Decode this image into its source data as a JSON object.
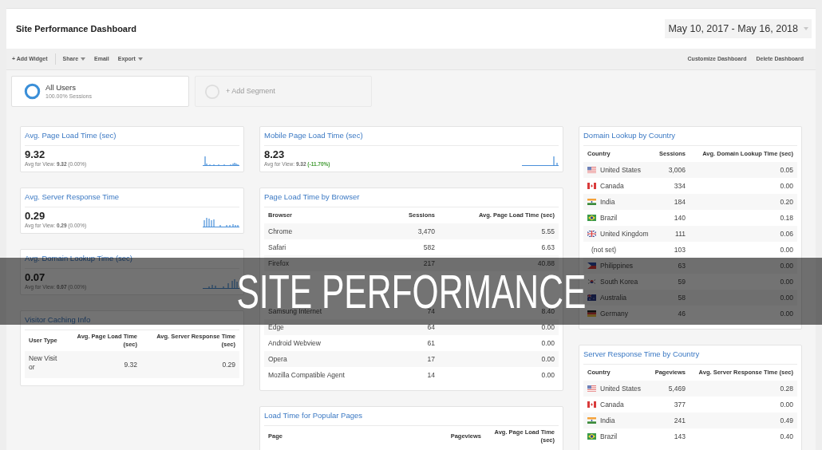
{
  "header": {
    "title": "Site Performance Dashboard",
    "date_range": "May 10, 2017 - May 16, 2018"
  },
  "toolbar": {
    "groups": [
      [
        {
          "label": "+ Add Widget",
          "kind": "action"
        }
      ],
      [
        {
          "label": "Share",
          "kind": "menu"
        },
        {
          "label": "Email",
          "kind": "action"
        },
        {
          "label": "Export",
          "kind": "menu"
        }
      ]
    ],
    "right": [
      {
        "label": "Customize Dashboard"
      },
      {
        "label": "Delete Dashboard"
      }
    ]
  },
  "segments": [
    {
      "kind": "active",
      "name": "All Users",
      "detail": "100.00% Sessions"
    },
    {
      "kind": "add",
      "name": "+ Add Segment"
    }
  ],
  "columns": [
    {
      "widgets": [
        {
          "kind": "scorecard",
          "title": "Avg. Page Load Time (sec)",
          "value": "9.32",
          "comparison": {
            "label": "Avg for View:",
            "value": "9.32",
            "change": "(0.00%)",
            "improved": false
          }
        },
        {
          "kind": "scorecard",
          "title": "Avg. Server Response Time",
          "value": "0.29",
          "comparison": {
            "label": "Avg for View:",
            "value": "0.29",
            "change": "(0.00%)",
            "improved": false
          }
        },
        {
          "kind": "scorecard",
          "title": "Avg. Domain Lookup Time (sec)",
          "value": "0.07",
          "comparison": {
            "label": "Avg for View:",
            "value": "0.07",
            "change": "(0.00%)",
            "improved": false
          }
        },
        {
          "kind": "table",
          "title": "Visitor Caching Info",
          "columns": [
            "User Type",
            "Avg. Page Load Time (sec)",
            "Avg. Server Response Time (sec)"
          ],
          "rows": [
            {
              "cells": [
                "New Visitor",
                "9.32",
                "0.29"
              ]
            }
          ]
        }
      ]
    },
    {
      "widgets": [
        {
          "kind": "scorecard",
          "title": "Mobile Page Load Time (sec)",
          "value": "8.23",
          "comparison": {
            "label": "Avg for View:",
            "value": "9.32",
            "change": "(-11.70%)",
            "improved": true
          }
        },
        {
          "kind": "table",
          "title": "Page Load Time by Browser",
          "columns": [
            "Browser",
            "Sessions",
            "Avg. Page Load Time (sec)"
          ],
          "rows": [
            {
              "cells": [
                "Chrome",
                "3,470",
                "5.55"
              ]
            },
            {
              "cells": [
                "Safari",
                "582",
                "6.63"
              ]
            },
            {
              "cells": [
                "Firefox",
                "217",
                "40.88"
              ]
            },
            {
              "cells": [
                null,
                null,
                null
              ]
            },
            {
              "cells": [
                null,
                null,
                null
              ]
            },
            {
              "cells": [
                "Samsung Internet",
                "74",
                "8.40"
              ]
            },
            {
              "cells": [
                "Edge",
                "64",
                "0.00"
              ]
            },
            {
              "cells": [
                "Android Webview",
                "61",
                "0.00"
              ]
            },
            {
              "cells": [
                "Opera",
                "17",
                "0.00"
              ]
            },
            {
              "cells": [
                "Mozilla Compatible Agent",
                "14",
                "0.00"
              ]
            }
          ]
        },
        {
          "kind": "table",
          "title": "Load Time for Popular Pages",
          "columns": [
            "Page",
            "Pageviews",
            "Avg. Page Load Time (sec)"
          ]
        }
      ]
    },
    {
      "widgets": [
        {
          "kind": "table",
          "title": "Domain Lookup by Country",
          "columns": [
            "Country",
            "Sessions",
            "Avg. Domain Lookup Time (sec)"
          ],
          "rows": [
            {
              "kind": "us",
              "cells": [
                "United States",
                "3,006",
                "0.05"
              ]
            },
            {
              "kind": "ca",
              "cells": [
                "Canada",
                "334",
                "0.00"
              ]
            },
            {
              "kind": "in",
              "cells": [
                "India",
                "184",
                "0.20"
              ]
            },
            {
              "kind": "br",
              "cells": [
                "Brazil",
                "140",
                "0.18"
              ]
            },
            {
              "kind": "gb",
              "cells": [
                "United Kingdom",
                "111",
                "0.06"
              ]
            },
            {
              "kind": "none",
              "cells": [
                "(not set)",
                "103",
                "0.00"
              ]
            },
            {
              "kind": "ph",
              "cells": [
                "Philippines",
                "63",
                "0.00"
              ]
            },
            {
              "kind": "kr",
              "cells": [
                "South Korea",
                "59",
                "0.00"
              ]
            },
            {
              "kind": "au",
              "cells": [
                "Australia",
                "58",
                "0.00"
              ]
            },
            {
              "kind": "de",
              "cells": [
                "Germany",
                "46",
                "0.00"
              ]
            }
          ]
        },
        {
          "kind": "table",
          "title": "Server Response Time by Country",
          "columns": [
            "Country",
            "Pageviews",
            "Avg. Server Response Time (sec)"
          ],
          "rows": [
            {
              "kind": "us",
              "cells": [
                "United States",
                "5,469",
                "0.28"
              ]
            },
            {
              "kind": "ca",
              "cells": [
                "Canada",
                "377",
                "0.00"
              ]
            },
            {
              "kind": "in",
              "cells": [
                "India",
                "241",
                "0.49"
              ]
            },
            {
              "kind": "br",
              "cells": [
                "Brazil",
                "143",
                "0.40"
              ]
            }
          ]
        }
      ]
    }
  ],
  "banner": {
    "title": "SITE PERFORMANCE"
  }
}
